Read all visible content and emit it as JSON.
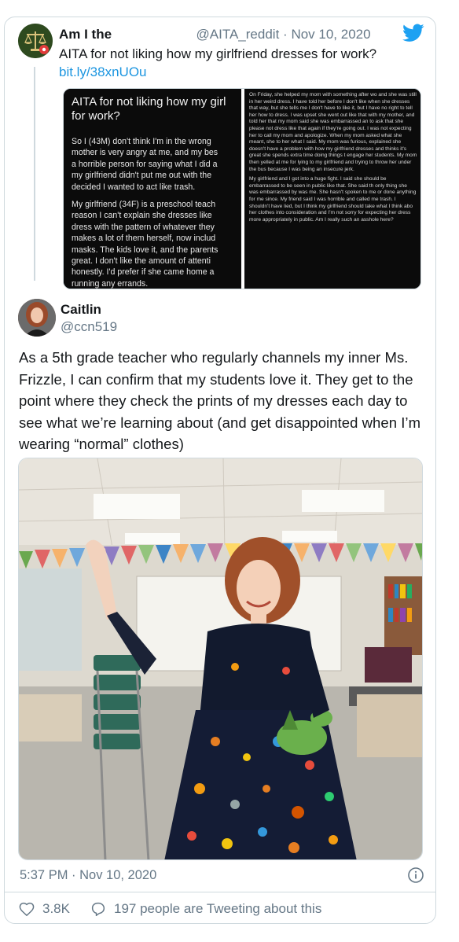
{
  "quoted_tweet": {
    "display_name": "Am I the",
    "handle": "@AITA_reddit",
    "separator": "·",
    "date": "Nov 10, 2020",
    "text": "AITA for not liking how my girlfriend dresses for work?",
    "link": "bit.ly/38xnUOu"
  },
  "aita_screenshot": {
    "title": "AITA for not liking how my girl for work?",
    "title_line1": "AITA for not liking how my girl",
    "title_line2": "for work?",
    "left_paragraphs": [
      [
        "So I (43M) don't think I'm in the wrong",
        "mother is very angry at me, and my bes",
        "a horrible person for saying what I did a",
        "my girlfriend didn't put me out with the",
        "decided I wanted to act like trash."
      ],
      [
        "My girlfriend (34F) is a preschool teach",
        "reason I can't explain she dresses like",
        "dress with the pattern of whatever they",
        "makes a lot of them herself, now includ",
        "masks. The kids love it, and the parents",
        "great. I don't like the amount of attenti",
        "honestly. I'd prefer if she came home a",
        "running any errands."
      ]
    ],
    "right_paragraphs": [
      "On Friday, she helped my mom with something after wo and she was still in her weird dress. I have told her before I don't like when she dresses that way, but she tells me I don't have to like it, but I have no right to tell her how to dress. I was upset she went out like that with my mother, and told her that my mom said she was embarrassed an to ask that she please not dress like that again if they're going out. I was not expecting her to call my mom and apologize. When my mom asked what she meant, she to her what I said. My mom was furious, explained she doesn't have a problem with how my girlfriend dresses and thinks it's great she spends extra time doing things t engage her students. My mom then yelled at me for lying to my girlfriend and trying to throw her under the bus because I was being an insecure jerk.",
      "My girlfriend and I got into a huge fight. I said she should be embarrassed to be seen in public like that. She said th only thing she was embarrassed by was me. She hasn't spoken to me or done anything for me since. My friend said I was horrible and called me trash. I shouldn't have lied, but I think my girlfriend should take what I think abo her clothes into consideration and I'm not sorry for expecting her dress more appropriately in public. Am I really such an asshole here?"
    ]
  },
  "main_tweet": {
    "display_name": "Caitlin",
    "handle": "@ccn519",
    "text": "As a 5th grade teacher who regularly channels my inner Ms. Frizzle, I can confirm that my students love it. They get to the point where they check the prints of my dresses each day to see what we’re learning about (and get disappointed when I’m wearing “normal” clothes)",
    "time": "5:37 PM · Nov 10, 2020"
  },
  "stats": {
    "likes": "3.8K",
    "conversation": "197 people are Tweeting about this"
  },
  "colors": {
    "twitter_blue": "#1da1f2",
    "link": "#1b95e0",
    "secondary_text": "#657786",
    "border": "#cfd9de"
  }
}
